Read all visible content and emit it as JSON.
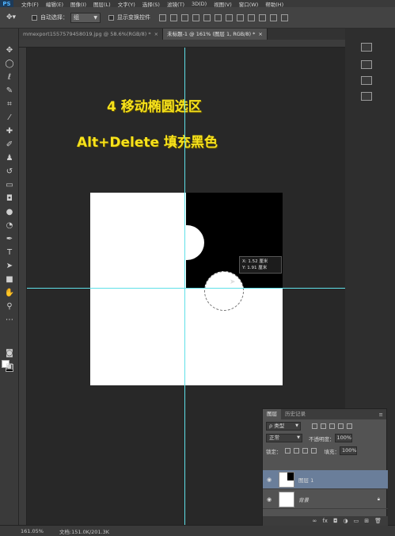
{
  "app": {
    "logo": "PS"
  },
  "menu": [
    "文件(F)",
    "编辑(E)",
    "图像(I)",
    "图层(L)",
    "文字(Y)",
    "选择(S)",
    "滤镜(T)",
    "3D(D)",
    "视图(V)",
    "窗口(W)",
    "帮助(H)"
  ],
  "options": {
    "auto_select_label": "自动选择：",
    "auto_select_value": "组",
    "show_transform_label": "显示变换控件"
  },
  "tabs": [
    {
      "label": "mmexport1557579458019.jpg @ 58.6%(RGB/8) *",
      "close": "×"
    },
    {
      "label": "未标题-1 @ 161% (图层 1, RGB/8) *",
      "close": "×"
    }
  ],
  "canvas": {
    "title_line1": "4 移动椭圆选区",
    "title_line2": "Alt+Delete 填充黑色",
    "hud_line1": "X: 1.52 厘米",
    "hud_line2": "Y: 1.91 厘米"
  },
  "status": {
    "zoom": "161.05%",
    "doc_info": "文档:151.0K/201.3K"
  },
  "layers_panel": {
    "tab_layers": "图层",
    "tab_history": "历史记录",
    "filter_label": "ρ 类型",
    "blend_mode": "正常",
    "opacity_label": "不透明度：",
    "opacity_value": "100%",
    "lock_label": "锁定：",
    "fill_label": "填充：",
    "fill_value": "100%",
    "layers": [
      {
        "name": "图层 1",
        "selected": true
      },
      {
        "name": "背景",
        "selected": false
      }
    ]
  },
  "colors": {
    "guide": "#5fe0e8",
    "title_text": "#f7e21b",
    "selected_layer": "#6a7e9a"
  }
}
